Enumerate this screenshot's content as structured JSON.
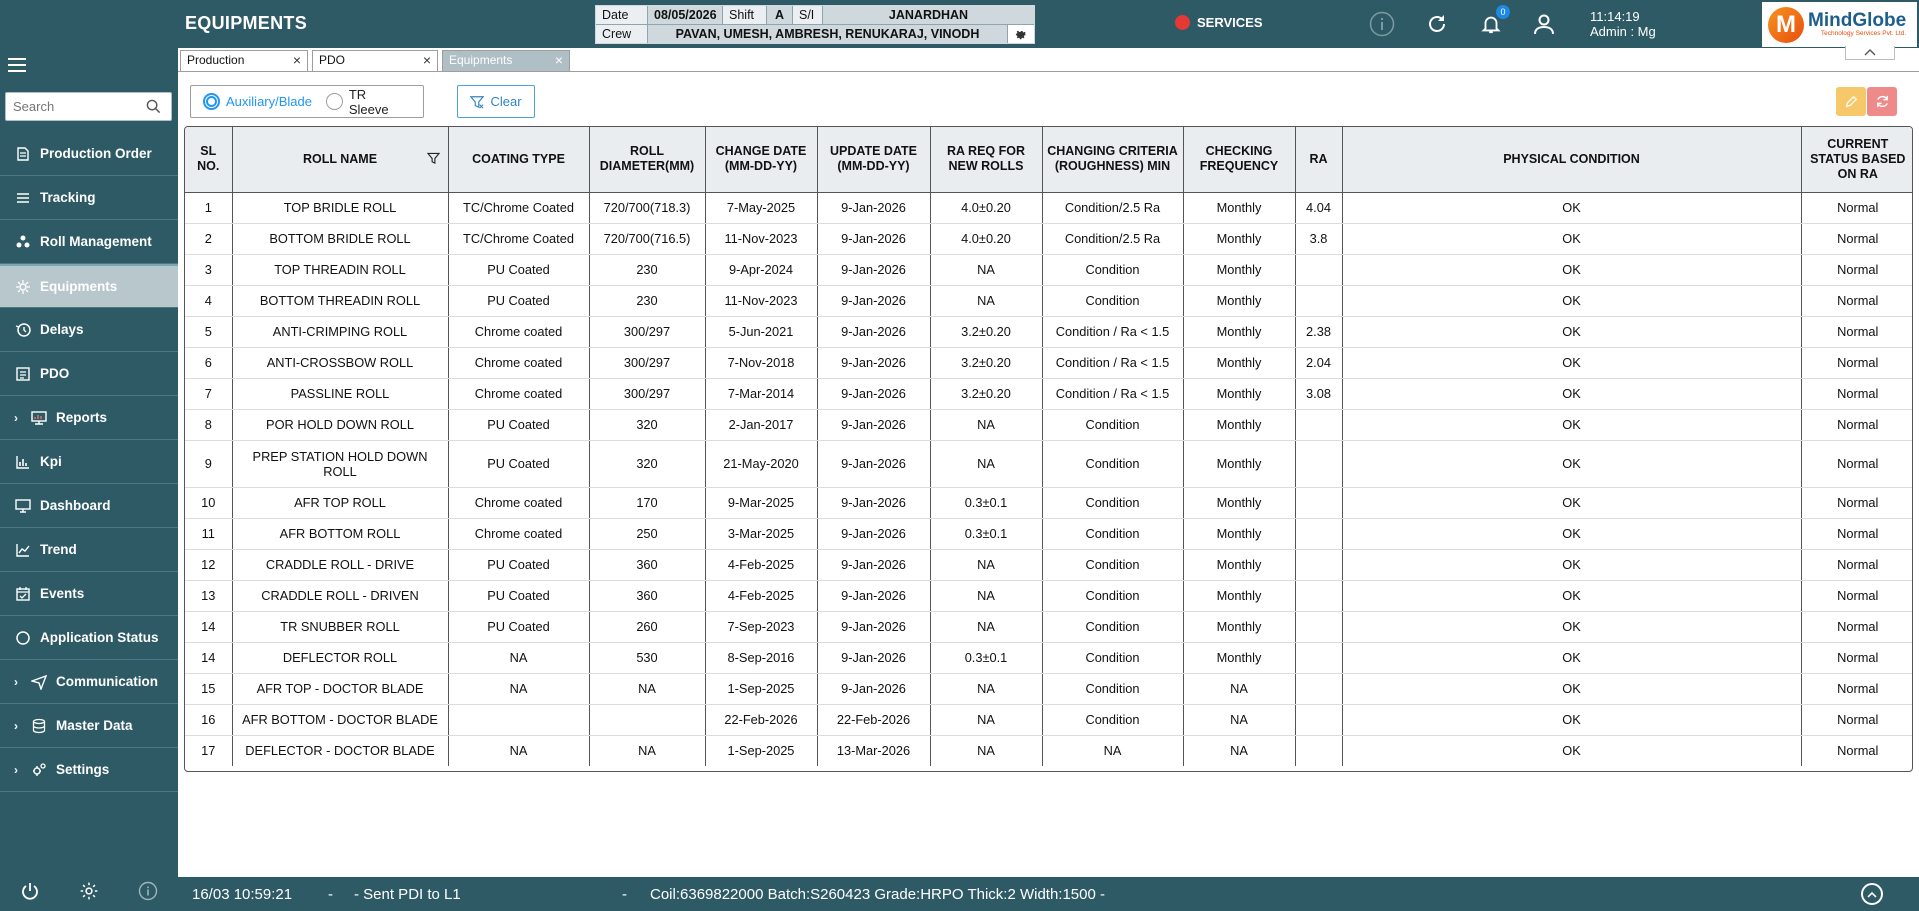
{
  "header": {
    "title": "EQUIPMENTS",
    "date_label": "Date",
    "date_value": "08/05/2026",
    "shift_label": "Shift",
    "shift_value": "A",
    "si_label": "S/I",
    "si_value": "JANARDHAN",
    "crew_label": "Crew",
    "crew_value": "PAVAN, UMESH, AMBRESH, RENUKARAJ, VINODH",
    "services_label": "SERVICES",
    "notification_count": "0",
    "time": "11:14:19",
    "user": "Admin : Mg",
    "logo_name": "MindGlobe",
    "logo_sub": "Technology Services Pvt. Ltd."
  },
  "sidebar": {
    "search_placeholder": "Search",
    "items": [
      {
        "label": "Production Order",
        "icon": "production-order-icon",
        "expandable": false,
        "active": false
      },
      {
        "label": "Tracking",
        "icon": "tracking-icon",
        "expandable": false,
        "active": false
      },
      {
        "label": "Roll Management",
        "icon": "roll-management-icon",
        "expandable": false,
        "active": false
      },
      {
        "label": "Equipments",
        "icon": "equipments-icon",
        "expandable": false,
        "active": true
      },
      {
        "label": "Delays",
        "icon": "delays-icon",
        "expandable": false,
        "active": false
      },
      {
        "label": "PDO",
        "icon": "pdo-icon",
        "expandable": false,
        "active": false
      },
      {
        "label": "Reports",
        "icon": "reports-icon",
        "expandable": true,
        "active": false
      },
      {
        "label": "Kpi",
        "icon": "kpi-icon",
        "expandable": false,
        "active": false
      },
      {
        "label": "Dashboard",
        "icon": "dashboard-icon",
        "expandable": false,
        "active": false
      },
      {
        "label": "Trend",
        "icon": "trend-icon",
        "expandable": false,
        "active": false
      },
      {
        "label": "Events",
        "icon": "events-icon",
        "expandable": false,
        "active": false
      },
      {
        "label": "Application Status",
        "icon": "application-status-icon",
        "expandable": false,
        "active": false
      },
      {
        "label": "Communication",
        "icon": "communication-icon",
        "expandable": true,
        "active": false
      },
      {
        "label": "Master Data",
        "icon": "master-data-icon",
        "expandable": true,
        "active": false
      },
      {
        "label": "Settings",
        "icon": "settings-icon",
        "expandable": true,
        "active": false
      }
    ]
  },
  "tabs": [
    {
      "label": "Production",
      "active": false
    },
    {
      "label": "PDO",
      "active": false
    },
    {
      "label": "Equipments",
      "active": true
    }
  ],
  "toolbar": {
    "radio_options": [
      {
        "label": "Auxiliary/Blade",
        "checked": true
      },
      {
        "label": "TR Sleeve",
        "checked": false
      }
    ],
    "clear_label": "Clear"
  },
  "table": {
    "columns": [
      {
        "label": "SL NO."
      },
      {
        "label": "ROLL NAME"
      },
      {
        "label": "COATING TYPE"
      },
      {
        "label": "ROLL DIAMETER(MM)"
      },
      {
        "label": "CHANGE DATE (MM-DD-YY)"
      },
      {
        "label": "UPDATE DATE (MM-DD-YY)"
      },
      {
        "label": "RA REQ FOR NEW ROLLS"
      },
      {
        "label": "CHANGING CRITERIA (ROUGHNESS) MIN"
      },
      {
        "label": "CHECKING FREQUENCY"
      },
      {
        "label": "RA"
      },
      {
        "label": "PHYSICAL CONDITION"
      },
      {
        "label": "CURRENT STATUS BASED ON RA"
      }
    ],
    "rows": [
      [
        "1",
        "TOP BRIDLE ROLL",
        "TC/Chrome Coated",
        "720/700(718.3)",
        "7-May-2025",
        "9-Jan-2026",
        "4.0±0.20",
        "Condition/2.5 Ra",
        "Monthly",
        "4.04",
        "OK",
        "Normal"
      ],
      [
        "2",
        "BOTTOM BRIDLE ROLL",
        "TC/Chrome Coated",
        "720/700(716.5)",
        "11-Nov-2023",
        "9-Jan-2026",
        "4.0±0.20",
        "Condition/2.5 Ra",
        "Monthly",
        "3.8",
        "OK",
        "Normal"
      ],
      [
        "3",
        "TOP THREADIN ROLL",
        "PU Coated",
        "230",
        "9-Apr-2024",
        "9-Jan-2026",
        "NA",
        "Condition",
        "Monthly",
        "",
        "OK",
        "Normal"
      ],
      [
        "4",
        "BOTTOM THREADIN ROLL",
        "PU Coated",
        "230",
        "11-Nov-2023",
        "9-Jan-2026",
        "NA",
        "Condition",
        "Monthly",
        "",
        "OK",
        "Normal"
      ],
      [
        "5",
        "ANTI-CRIMPING ROLL",
        "Chrome coated",
        "300/297",
        "5-Jun-2021",
        "9-Jan-2026",
        "3.2±0.20",
        "Condition / Ra < 1.5",
        "Monthly",
        "2.38",
        "OK",
        "Normal"
      ],
      [
        "6",
        "ANTI-CROSSBOW ROLL",
        "Chrome coated",
        "300/297",
        "7-Nov-2018",
        "9-Jan-2026",
        "3.2±0.20",
        "Condition / Ra < 1.5",
        "Monthly",
        "2.04",
        "OK",
        "Normal"
      ],
      [
        "7",
        "PASSLINE ROLL",
        "Chrome coated",
        "300/297",
        "7-Mar-2014",
        "9-Jan-2026",
        "3.2±0.20",
        "Condition / Ra < 1.5",
        "Monthly",
        "3.08",
        "OK",
        "Normal"
      ],
      [
        "8",
        "POR HOLD DOWN ROLL",
        "PU Coated",
        "320",
        "2-Jan-2017",
        "9-Jan-2026",
        "NA",
        "Condition",
        "Monthly",
        "",
        "OK",
        "Normal"
      ],
      [
        "9",
        "PREP STATION HOLD DOWN ROLL",
        "PU Coated",
        "320",
        "21-May-2020",
        "9-Jan-2026",
        "NA",
        "Condition",
        "Monthly",
        "",
        "OK",
        "Normal"
      ],
      [
        "10",
        "AFR TOP ROLL",
        "Chrome coated",
        "170",
        "9-Mar-2025",
        "9-Jan-2026",
        "0.3±0.1",
        "Condition",
        "Monthly",
        "",
        "OK",
        "Normal"
      ],
      [
        "11",
        "AFR BOTTOM ROLL",
        "Chrome coated",
        "250",
        "3-Mar-2025",
        "9-Jan-2026",
        "0.3±0.1",
        "Condition",
        "Monthly",
        "",
        "OK",
        "Normal"
      ],
      [
        "12",
        "CRADDLE ROLL - DRIVE",
        "PU Coated",
        "360",
        "4-Feb-2025",
        "9-Jan-2026",
        "NA",
        "Condition",
        "Monthly",
        "",
        "OK",
        "Normal"
      ],
      [
        "13",
        "CRADDLE ROLL - DRIVEN",
        "PU Coated",
        "360",
        "4-Feb-2025",
        "9-Jan-2026",
        "NA",
        "Condition",
        "Monthly",
        "",
        "OK",
        "Normal"
      ],
      [
        "14",
        "TR SNUBBER ROLL",
        "PU Coated",
        "260",
        "7-Sep-2023",
        "9-Jan-2026",
        "NA",
        "Condition",
        "Monthly",
        "",
        "OK",
        "Normal"
      ],
      [
        "14",
        "DEFLECTOR ROLL",
        "NA",
        "530",
        "8-Sep-2016",
        "9-Jan-2026",
        "0.3±0.1",
        "Condition",
        "Monthly",
        "",
        "OK",
        "Normal"
      ],
      [
        "15",
        "AFR TOP - DOCTOR BLADE",
        "NA",
        "NA",
        "1-Sep-2025",
        "9-Jan-2026",
        "NA",
        "Condition",
        "NA",
        "",
        "OK",
        "Normal"
      ],
      [
        "16",
        "AFR BOTTOM - DOCTOR BLADE",
        "",
        "",
        "22-Feb-2026",
        "22-Feb-2026",
        "NA",
        "Condition",
        "NA",
        "",
        "OK",
        "Normal"
      ],
      [
        "17",
        "DEFLECTOR - DOCTOR BLADE",
        "NA",
        "NA",
        "1-Sep-2025",
        "13-Mar-2026",
        "NA",
        "NA",
        "NA",
        "",
        "OK",
        "Normal"
      ]
    ]
  },
  "statusbar": {
    "timestamp": "16/03 10:59:21",
    "sep1": "-",
    "message": "- Sent PDI to L1",
    "sep2": "-",
    "coil_info": "Coil:6369822000 Batch:S260423 Grade:HRPO Thick:2 Width:1500 -"
  },
  "colors": {
    "header_bg": "#2e5a66",
    "accent_blue": "#2196f3",
    "services_dot": "#e53935",
    "edit_button": "#f6c86a",
    "refresh_button": "#ef8a8a"
  }
}
